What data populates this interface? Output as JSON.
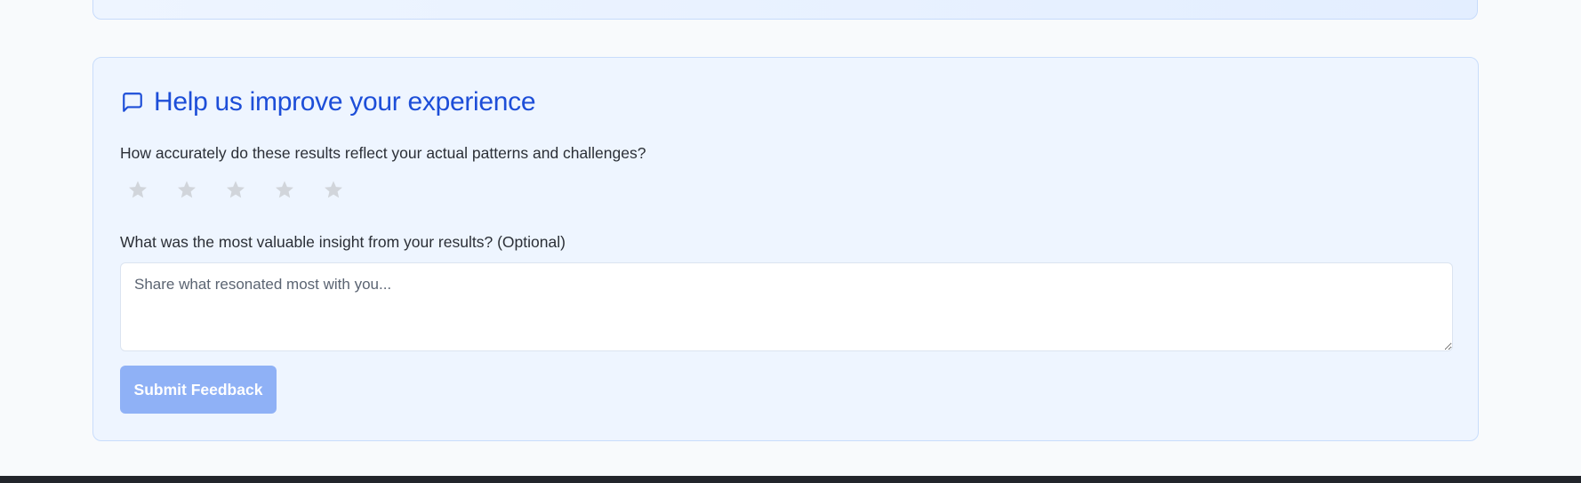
{
  "feedback": {
    "title": "Help us improve your experience",
    "title_icon": "chat-bubble-icon",
    "accuracy_question": "How accurately do these results reflect your actual patterns and challenges?",
    "rating": {
      "max": 5,
      "selected": 0,
      "star_icon": "star-icon",
      "empty_color": "#d1d5db"
    },
    "insight_question": "What was the most valuable insight from your results? (Optional)",
    "insight_placeholder": "Share what resonated most with you...",
    "insight_value": "",
    "submit_label": "Submit Feedback"
  },
  "colors": {
    "accent": "#1d4ed8",
    "card_background": "#eef5ff",
    "card_border": "#c9ddfb",
    "button_disabled": "#8fb1f6",
    "page_background": "#f8fafc",
    "footer": "#22252b"
  }
}
